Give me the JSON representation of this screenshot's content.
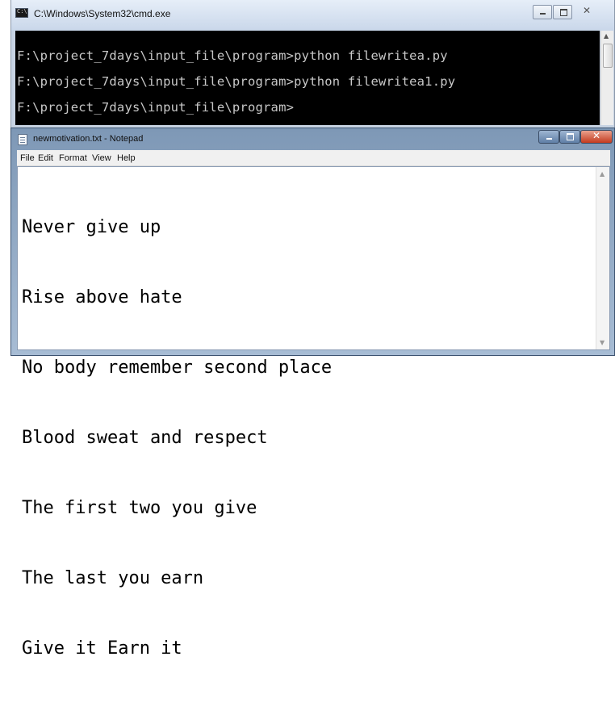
{
  "cmd": {
    "title": "C:\\Windows\\System32\\cmd.exe",
    "lines": [
      "F:\\project_7days\\input_file\\program>python filewritea.py",
      "F:\\project_7days\\input_file\\program>python filewritea1.py",
      "F:\\project_7days\\input_file\\program>"
    ]
  },
  "notepad": {
    "title": "newmotivation.txt - Notepad",
    "menu": [
      "File",
      "Edit",
      "Format",
      "View",
      "Help"
    ],
    "lines": [
      "Never give up",
      "Rise above hate",
      "No body remember second place",
      "Blood sweat and respect",
      "The first two you give",
      "The last you earn",
      "Give it Earn it"
    ]
  },
  "icons": {
    "cmd_app": "console-icon",
    "notepad_app": "notepad-icon",
    "minimize": "minimize-icon",
    "maximize": "maximize-icon",
    "close": "close-icon"
  },
  "colors": {
    "console_bg": "#000000",
    "console_text": "#c8c8c8",
    "notepad_close": "#c33a1e"
  }
}
